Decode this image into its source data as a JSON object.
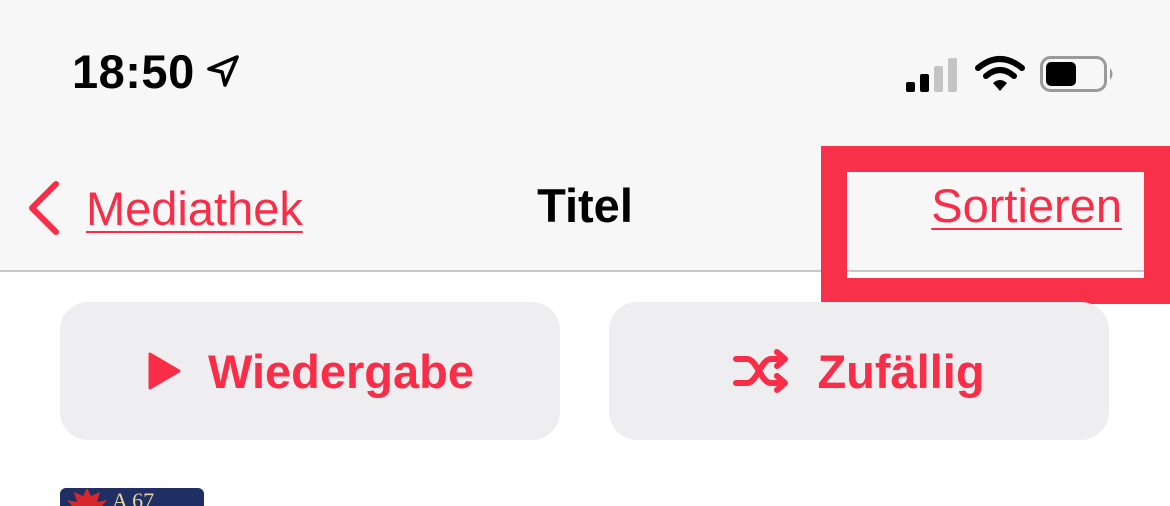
{
  "status_bar": {
    "time": "18:50",
    "location_icon": "location-arrow-icon",
    "signal_icon": "cellular-signal-icon",
    "wifi_icon": "wifi-icon",
    "battery_icon": "battery-icon",
    "battery_level": 0.55
  },
  "nav": {
    "back_label": "Mediathek",
    "title": "Titel",
    "sort_label": "Sortieren"
  },
  "actions": {
    "play_label": "Wiedergabe",
    "shuffle_label": "Zufällig"
  },
  "list": {
    "first_item_art_text": "A 67"
  },
  "colors": {
    "accent": "#fa2d48",
    "highlight": "#f8304a",
    "button_bg": "#eeeef0",
    "bar_bg": "#f7f7f7"
  }
}
